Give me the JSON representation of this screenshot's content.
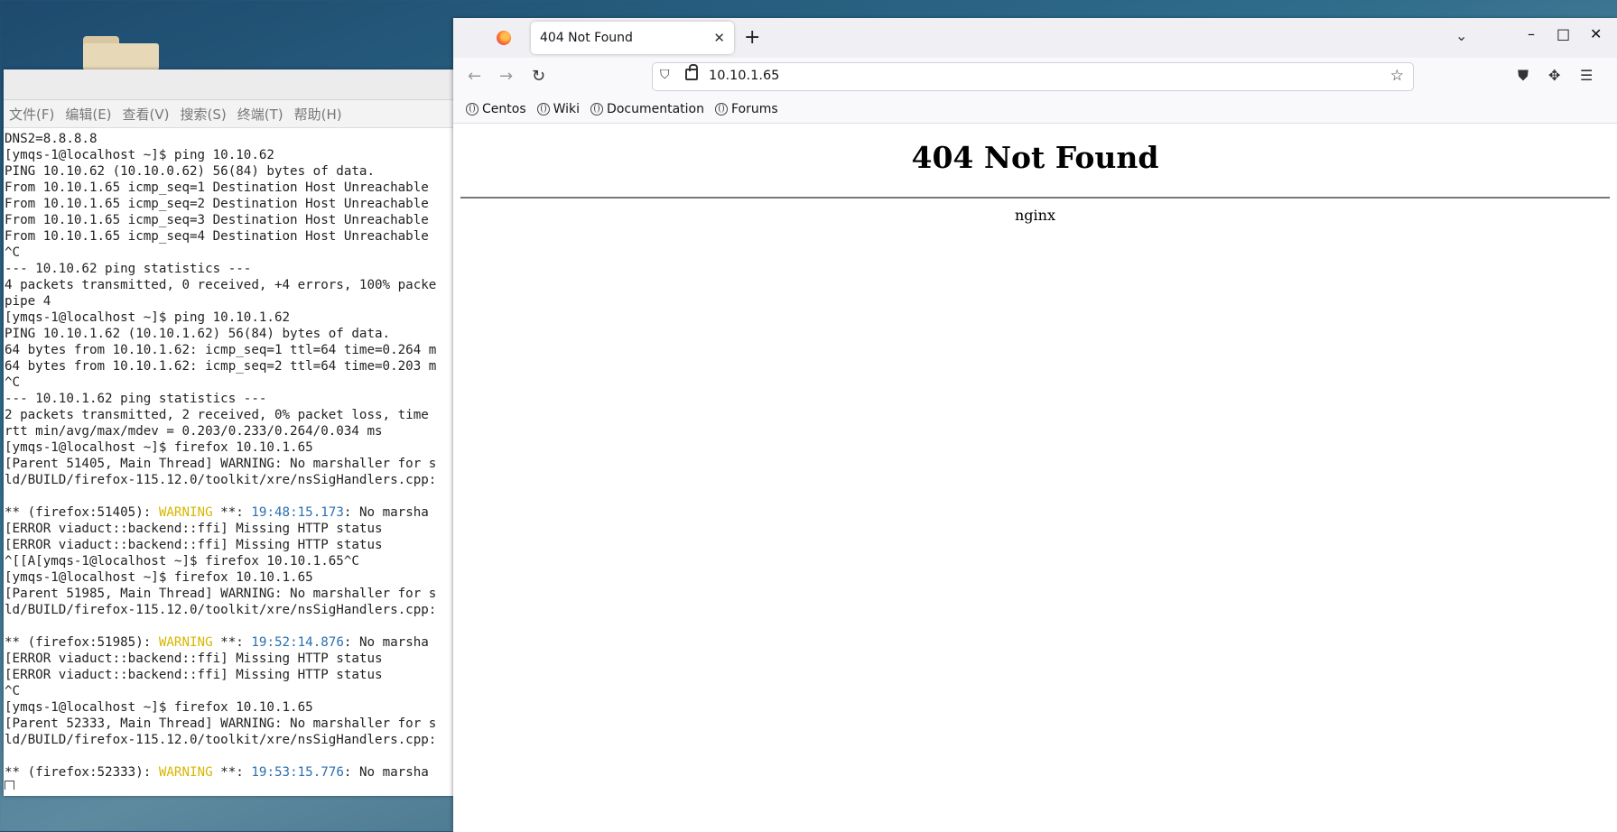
{
  "terminal": {
    "menu": [
      "文件(F)",
      "编辑(E)",
      "查看(V)",
      "搜索(S)",
      "终端(T)",
      "帮助(H)"
    ],
    "lines": [
      [
        {
          "t": "DNS2=8.8.8.8"
        }
      ],
      [
        {
          "t": "[ymqs-1@localhost ~]$ ping 10.10.62"
        }
      ],
      [
        {
          "t": "PING 10.10.62 (10.10.0.62) 56(84) bytes of data."
        }
      ],
      [
        {
          "t": "From 10.10.1.65 icmp_seq=1 Destination Host Unreachable"
        }
      ],
      [
        {
          "t": "From 10.10.1.65 icmp_seq=2 Destination Host Unreachable"
        }
      ],
      [
        {
          "t": "From 10.10.1.65 icmp_seq=3 Destination Host Unreachable"
        }
      ],
      [
        {
          "t": "From 10.10.1.65 icmp_seq=4 Destination Host Unreachable"
        }
      ],
      [
        {
          "t": "^C"
        }
      ],
      [
        {
          "t": "--- 10.10.62 ping statistics ---"
        }
      ],
      [
        {
          "t": "4 packets transmitted, 0 received, +4 errors, 100% packe"
        }
      ],
      [
        {
          "t": "pipe 4"
        }
      ],
      [
        {
          "t": "[ymqs-1@localhost ~]$ ping 10.10.1.62"
        }
      ],
      [
        {
          "t": "PING 10.10.1.62 (10.10.1.62) 56(84) bytes of data."
        }
      ],
      [
        {
          "t": "64 bytes from 10.10.1.62: icmp_seq=1 ttl=64 time=0.264 m"
        }
      ],
      [
        {
          "t": "64 bytes from 10.10.1.62: icmp_seq=2 ttl=64 time=0.203 m"
        }
      ],
      [
        {
          "t": "^C"
        }
      ],
      [
        {
          "t": "--- 10.10.1.62 ping statistics ---"
        }
      ],
      [
        {
          "t": "2 packets transmitted, 2 received, 0% packet loss, time"
        }
      ],
      [
        {
          "t": "rtt min/avg/max/mdev = 0.203/0.233/0.264/0.034 ms"
        }
      ],
      [
        {
          "t": "[ymqs-1@localhost ~]$ firefox 10.10.1.65"
        }
      ],
      [
        {
          "t": "[Parent 51405, Main Thread] WARNING: No marshaller for s"
        }
      ],
      [
        {
          "t": "ld/BUILD/firefox-115.12.0/toolkit/xre/nsSigHandlers.cpp:"
        }
      ],
      [
        {
          "t": ""
        }
      ],
      [
        {
          "t": "** (firefox:51405): "
        },
        {
          "t": "WARNING",
          "c": "yellow"
        },
        {
          "t": " **: "
        },
        {
          "t": "19:48:15.173",
          "c": "blue"
        },
        {
          "t": ": No marsha"
        }
      ],
      [
        {
          "t": "[ERROR viaduct::backend::ffi] Missing HTTP status"
        }
      ],
      [
        {
          "t": "[ERROR viaduct::backend::ffi] Missing HTTP status"
        }
      ],
      [
        {
          "t": "^[[A[ymqs-1@localhost ~]$ firefox 10.10.1.65^C"
        }
      ],
      [
        {
          "t": "[ymqs-1@localhost ~]$ firefox 10.10.1.65"
        }
      ],
      [
        {
          "t": "[Parent 51985, Main Thread] WARNING: No marshaller for s"
        }
      ],
      [
        {
          "t": "ld/BUILD/firefox-115.12.0/toolkit/xre/nsSigHandlers.cpp:"
        }
      ],
      [
        {
          "t": ""
        }
      ],
      [
        {
          "t": "** (firefox:51985): "
        },
        {
          "t": "WARNING",
          "c": "yellow"
        },
        {
          "t": " **: "
        },
        {
          "t": "19:52:14.876",
          "c": "blue"
        },
        {
          "t": ": No marsha"
        }
      ],
      [
        {
          "t": "[ERROR viaduct::backend::ffi] Missing HTTP status"
        }
      ],
      [
        {
          "t": "[ERROR viaduct::backend::ffi] Missing HTTP status"
        }
      ],
      [
        {
          "t": "^C"
        }
      ],
      [
        {
          "t": "[ymqs-1@localhost ~]$ firefox 10.10.1.65"
        }
      ],
      [
        {
          "t": "[Parent 52333, Main Thread] WARNING: No marshaller for s"
        }
      ],
      [
        {
          "t": "ld/BUILD/firefox-115.12.0/toolkit/xre/nsSigHandlers.cpp:"
        }
      ],
      [
        {
          "t": ""
        }
      ],
      [
        {
          "t": "** (firefox:52333): "
        },
        {
          "t": "WARNING",
          "c": "yellow"
        },
        {
          "t": " **: "
        },
        {
          "t": "19:53:15.776",
          "c": "blue"
        },
        {
          "t": ": No marsha"
        }
      ]
    ]
  },
  "browser": {
    "tab_title": "404 Not Found",
    "tab_close": "✕",
    "new_tab": "+",
    "list_tabs": "⌄",
    "window_controls": {
      "minimize": "–",
      "maximize": "□",
      "close": "✕"
    },
    "nav": {
      "back": "←",
      "forward": "→",
      "reload": "↻"
    },
    "url": "10.10.1.65",
    "bookmarks": [
      "Centos",
      "Wiki",
      "Documentation",
      "Forums"
    ],
    "page": {
      "heading": "404 Not Found",
      "footer": "nginx"
    }
  }
}
